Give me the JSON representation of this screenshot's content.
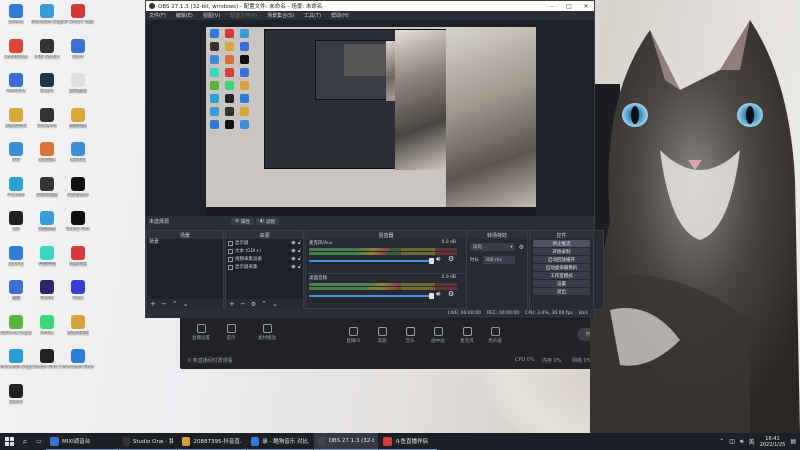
{
  "desktop": {
    "icons": [
      {
        "label": "cofovis",
        "color": "#2e7cd6"
      },
      {
        "label": "Microsoft Edge",
        "color": "#3a9bd6"
      },
      {
        "label": "HP Smart Tasks",
        "color": "#d23a3a"
      },
      {
        "label": "GoodNotes",
        "color": "#d6473a"
      },
      {
        "label": "OBS Studio",
        "color": "#333333"
      },
      {
        "label": "Word",
        "color": "#3a6fd6"
      },
      {
        "label": "Trendline",
        "color": "#3a6fd6"
      },
      {
        "label": "Steam",
        "color": "#223344"
      },
      {
        "label": "腾讯会议",
        "color": "#e0e0e0"
      },
      {
        "label": "网易云音乐",
        "color": "#d6a93a"
      },
      {
        "label": "WeGame",
        "color": "#333333"
      },
      {
        "label": "百度网盘",
        "color": "#d6a93a"
      },
      {
        "label": "钉钉",
        "color": "#3a8fd6"
      },
      {
        "label": "录屏软件",
        "color": "#d6743a"
      },
      {
        "label": "腾讯QQ",
        "color": "#3a8fd6"
      },
      {
        "label": "Thunder",
        "color": "#2ea0d6"
      },
      {
        "label": "剪映专业版",
        "color": "#333333"
      },
      {
        "label": "Wallpaper",
        "color": "#111111"
      },
      {
        "label": "QQ",
        "color": "#222222"
      },
      {
        "label": "阿里云盘",
        "color": "#3a9bd6"
      },
      {
        "label": "Studio One",
        "color": "#111111"
      },
      {
        "label": "Spotify",
        "color": "#2e7cd6"
      },
      {
        "label": "哔哩哔哩",
        "color": "#3ad6c0"
      },
      {
        "label": "网易有道",
        "color": "#d63a3a"
      },
      {
        "label": "百度",
        "color": "#3a6fd6"
      },
      {
        "label": "Game",
        "color": "#2a2a6a"
      },
      {
        "label": "Xbox",
        "color": "#3a3ad6"
      },
      {
        "label": "GeForce Experience",
        "color": "#5ab43a"
      },
      {
        "label": "Office",
        "color": "#3ad67a"
      },
      {
        "label": "谷歌浏览器",
        "color": "#d6a03a"
      },
      {
        "label": "Microsoft Edge",
        "color": "#2aa0d6"
      },
      {
        "label": "Studio One 5",
        "color": "#222222"
      },
      {
        "label": "Microsoft Store",
        "color": "#2e7cd6"
      },
      {
        "label": "记事本",
        "color": "#222222"
      }
    ]
  },
  "bg_window": {
    "items": [
      "直播设置",
      "提示",
      "素材播放"
    ],
    "toolbar": [
      "直播间",
      "美颜",
      "音乐",
      "画中画",
      "麦克风",
      "扬声器"
    ],
    "status_text": "0 条直播间付费观看",
    "pill": "开始直播",
    "cpu": "CPU 0%",
    "mem": "内存 0%",
    "net": "网络 0%"
  },
  "obs": {
    "title": "OBS 27.1.3 (32-bit, windows) - 配置文件: 未命名 - 场景: 未命名",
    "menu": [
      "文件(F)",
      "编辑(E)",
      "视图(V)",
      "配置文件(P)",
      "场景集合(S)",
      "工具(T)",
      "帮助(H)"
    ],
    "current_scene_label": "未选择源",
    "props_btn": "属性",
    "filter_btn": "滤镜",
    "docks": {
      "scenes": {
        "title": "场景",
        "items": [
          "场景"
        ]
      },
      "sources": {
        "title": "来源",
        "items": [
          "显示器",
          "文本 (GDI+)",
          "视频采集设备",
          "显示器采集"
        ]
      },
      "mixer": {
        "title": "混音器",
        "tracks": [
          {
            "name": "麦克风/Aux",
            "db": "0.0 dB"
          },
          {
            "name": "桌面音频",
            "db": "0.0 dB"
          }
        ]
      },
      "transitions": {
        "title": "转场特效",
        "type": "淡化",
        "duration_label": "时长",
        "duration": "300 ms"
      },
      "controls": {
        "title": "控件",
        "buttons": [
          "停止推流",
          "开始录制",
          "启动回放缓存",
          "启动虚拟摄像机",
          "工作室模式",
          "设置",
          "退出"
        ]
      }
    },
    "status": {
      "live": "LIVE: 00:00:00",
      "rec": "REC: 00:00:00",
      "cpu": "CPU: 3.0%, 30.00 fps",
      "kbps": "kb/s"
    }
  },
  "taskbar": {
    "apps": [
      {
        "label": "MIXI调音台",
        "color": "#3a6fd6"
      },
      {
        "label": "Studio One - 我的...",
        "color": "#333333"
      },
      {
        "label": "20887395-抖音直...",
        "color": "#d6a03a"
      },
      {
        "label": "录 - 酷狗音乐 对比...",
        "color": "#2e7cd6"
      },
      {
        "label": "OBS 27.1.3 (32-bi...",
        "color": "#444444"
      },
      {
        "label": "斗鱼直播伴侣",
        "color": "#d63a3a"
      }
    ],
    "time": "16:41",
    "date": "2022/1/25",
    "lang": "英"
  }
}
